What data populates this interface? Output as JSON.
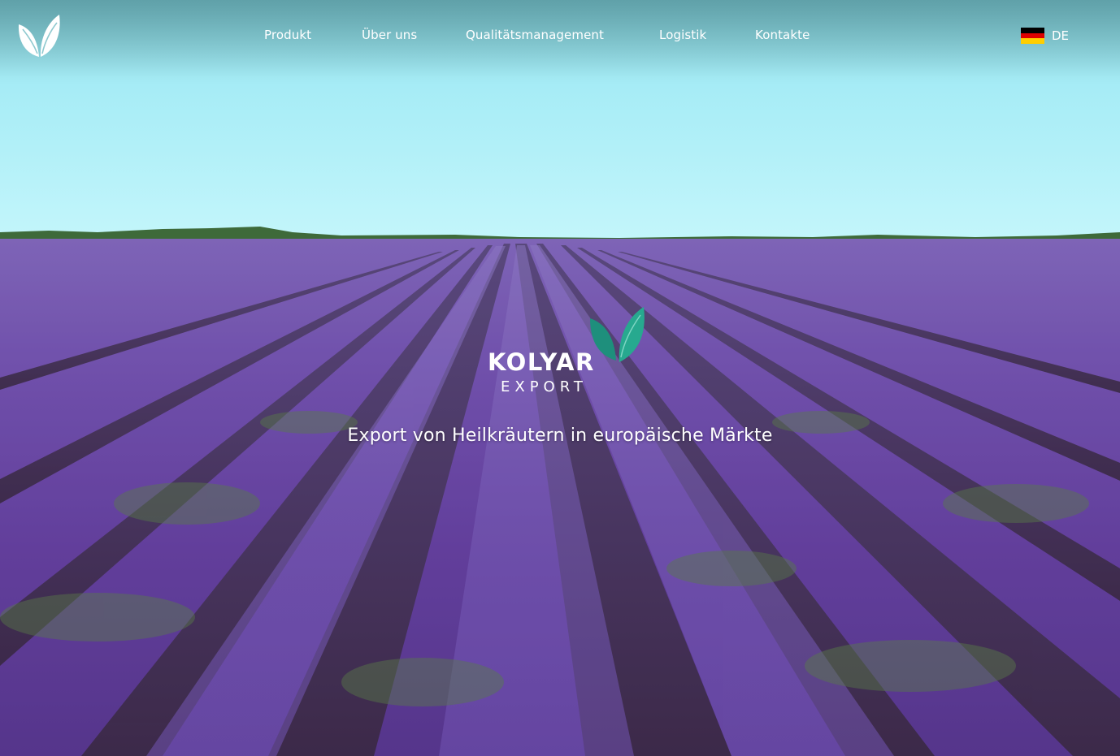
{
  "nav": {
    "items": [
      {
        "label": "Produkt"
      },
      {
        "label": "Über uns"
      },
      {
        "label": "Qualitätsmanagement"
      },
      {
        "label": "Logistik"
      },
      {
        "label": "Kontakte"
      }
    ],
    "language": {
      "label": "DE",
      "flag_icon": "german-flag-icon",
      "flag_colors": [
        "#000000",
        "#dd0000",
        "#ffce00"
      ]
    }
  },
  "logo_icon": "leaf-logo-icon",
  "hero": {
    "brand_name": "KOLYAR",
    "brand_sub": "EXPORT",
    "brand_leaf_icon": "teal-leaf-icon",
    "tagline": "Export von Heilkräutern in europäische Märkte",
    "colors": {
      "sky_top": "#8fd6dc",
      "sky_horizon": "#b9f4fb",
      "lavender": "#7b55b8",
      "leaf_green": "#1e9a84"
    }
  }
}
